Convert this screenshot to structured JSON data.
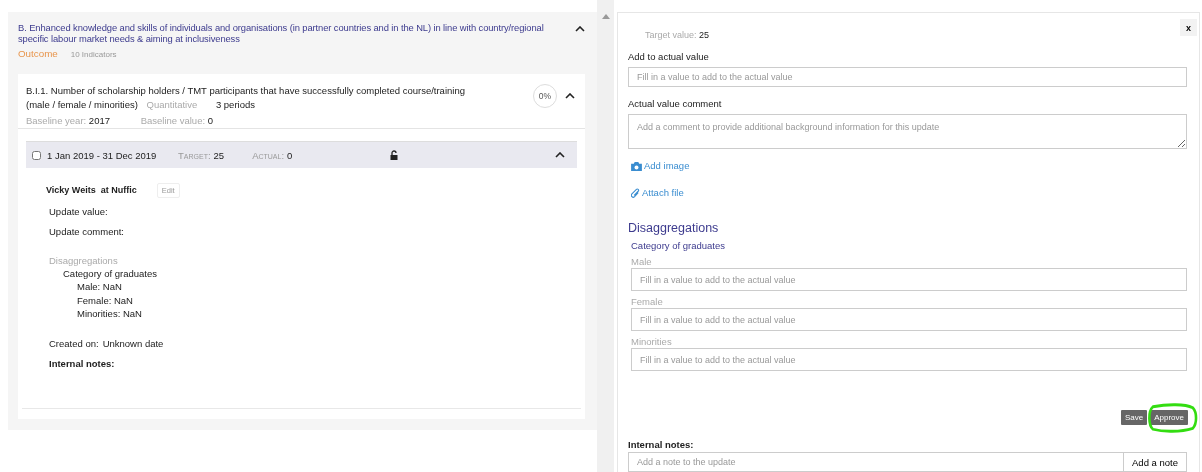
{
  "outcome": {
    "title": "B. Enhanced knowledge and skills of individuals and organisations (in partner countries and in the NL) in line with country/regional specific labour market needs & aiming at inclusiveness",
    "type": "Outcome",
    "indicator_count": "10 Indicators",
    "expanded": true,
    "indicator": {
      "title_lines": [
        "B.I.1. Number of scholarship holders / TMT participants that have successfully completed course/training",
        "(male / female / minorities)"
      ],
      "measure": "Quantitative",
      "periods": "3 periods",
      "progress": "0%",
      "expanded": true,
      "baseline_year_label": "Baseline year:",
      "baseline_year": "2017",
      "baseline_value_label": "Baseline value:",
      "baseline_value": "0",
      "period": {
        "checked": false,
        "range": "1 Jan 2019 - 31 Dec 2019",
        "target_label": "Target:",
        "target": "25",
        "actual_label": "Actual:",
        "actual": "0",
        "locked": false,
        "expanded": true,
        "update": {
          "author": "Vicky Weits",
          "org": "at Nuffic",
          "edit_button": "Edit",
          "edit_disabled": true,
          "value_label": "Update value:",
          "comment_label": "Update comment:",
          "disaggregations_label": "Disaggregations",
          "category": "Category of graduates",
          "items": [
            {
              "label": "Male: NaN"
            },
            {
              "label": "Female: NaN"
            },
            {
              "label": "Minorities: NaN"
            }
          ],
          "created_label": "Created on:",
          "created": "Unknown date",
          "notes_label": "Internal notes:"
        }
      }
    }
  },
  "update_form": {
    "close": "x",
    "target_label": "Target value:",
    "target": "25",
    "add_label": "Add to actual value",
    "add_placeholder": "Fill in a value to add to the actual value",
    "comment_label": "Actual value comment",
    "comment_placeholder": "Add a comment to provide additional background information for this update",
    "add_image": "Add image",
    "attach_file": "Attach file",
    "disaggregations_title": "Disaggregations",
    "category": "Category of graduates",
    "fields": [
      {
        "label": "Male",
        "placeholder": "Fill in a value to add to the actual value"
      },
      {
        "label": "Female",
        "placeholder": "Fill in a value to add to the actual value"
      },
      {
        "label": "Minorities",
        "placeholder": "Fill in a value to add to the actual value"
      }
    ],
    "buttons": [
      {
        "label": "Save",
        "highlighted": false
      },
      {
        "label": "Approve",
        "highlighted": true
      }
    ],
    "notes_label": "Internal notes:",
    "note_placeholder": "Add a note to the update",
    "add_note": "Add a note"
  }
}
